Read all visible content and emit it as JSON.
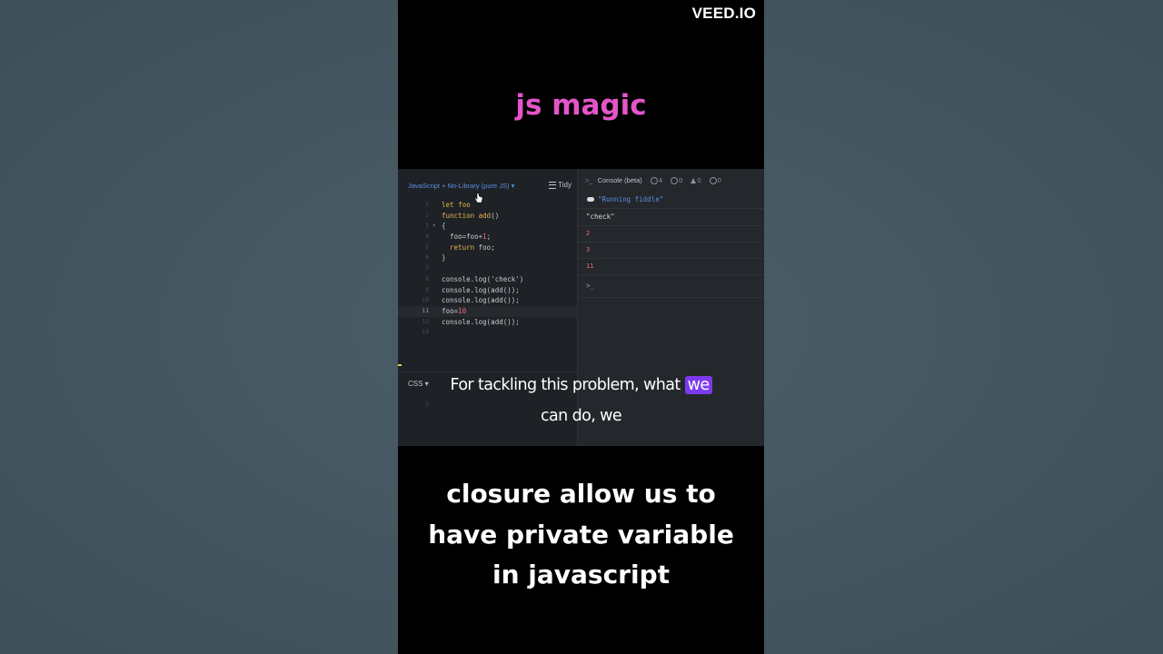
{
  "watermark": "VEED.IO",
  "headline": "js magic",
  "editor": {
    "js_header": "JavaScript + No-Library (pure JS) ▾",
    "tidy_label": "Tidy",
    "lines": [
      {
        "n": "1",
        "html": "<span class='kw'>let</span> <span class='fn'>foo</span>"
      },
      {
        "n": "2",
        "html": "<span class='kw'>function</span> <span class='fn'>add</span>()"
      },
      {
        "n": "3",
        "html": "{",
        "fold": "▾"
      },
      {
        "n": "4",
        "html": "  foo=foo+<span class='num'>1</span>;"
      },
      {
        "n": "5",
        "html": "  <span class='kw'>return</span> foo;"
      },
      {
        "n": "6",
        "html": "}"
      },
      {
        "n": "7",
        "html": ""
      },
      {
        "n": "8",
        "html": "console.log(<span class='str'>'check'</span>)"
      },
      {
        "n": "9",
        "html": "console.log(add());"
      },
      {
        "n": "10",
        "html": "console.log(add());"
      },
      {
        "n": "11",
        "html": "foo=<span class='num'>10</span>",
        "active": true
      },
      {
        "n": "12",
        "html": "console.log(add());"
      },
      {
        "n": "13",
        "html": ""
      }
    ],
    "css_header": "CSS ▾",
    "css_line": "1"
  },
  "console": {
    "prompt": ">_",
    "title": "Console (beta)",
    "info_count": "4",
    "error_count": "0",
    "warn_count": "0",
    "log_count": "0",
    "running": "\"Running fiddle\"",
    "outputs": [
      "\"check\"",
      "2",
      "3",
      "11"
    ],
    "input_prompt": ">_"
  },
  "caption": {
    "line1_pre": "For tackling this problem, what",
    "line1_hl": "we",
    "line2": "can do, we"
  },
  "bottom_text": [
    "closure allow us to",
    "have private variable",
    "in javascript"
  ]
}
